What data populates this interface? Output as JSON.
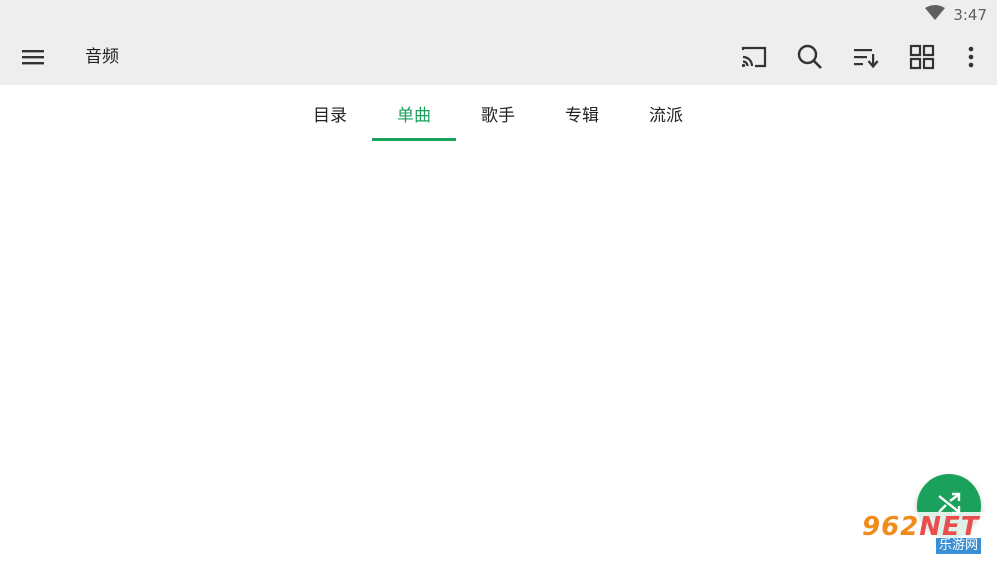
{
  "status_bar": {
    "time": "3:47",
    "wifi_icon": "wifi-icon"
  },
  "toolbar": {
    "menu_icon": "menu-icon",
    "title": "音频",
    "actions": [
      "cast-icon",
      "search-icon",
      "sort-icon",
      "grid-view-icon",
      "more-vert-icon"
    ]
  },
  "tabs": [
    {
      "label": "目录",
      "active": false
    },
    {
      "label": "单曲",
      "active": true
    },
    {
      "label": "歌手",
      "active": false
    },
    {
      "label": "专辑",
      "active": false
    },
    {
      "label": "流派",
      "active": false
    }
  ],
  "fab": {
    "icon": "shuffle-icon"
  },
  "watermark": {
    "main": "962",
    "suffix": "NET",
    "sub": "乐游网"
  },
  "colors": {
    "accent": "#1aa15c",
    "toolbar_bg": "#eeeeee"
  }
}
